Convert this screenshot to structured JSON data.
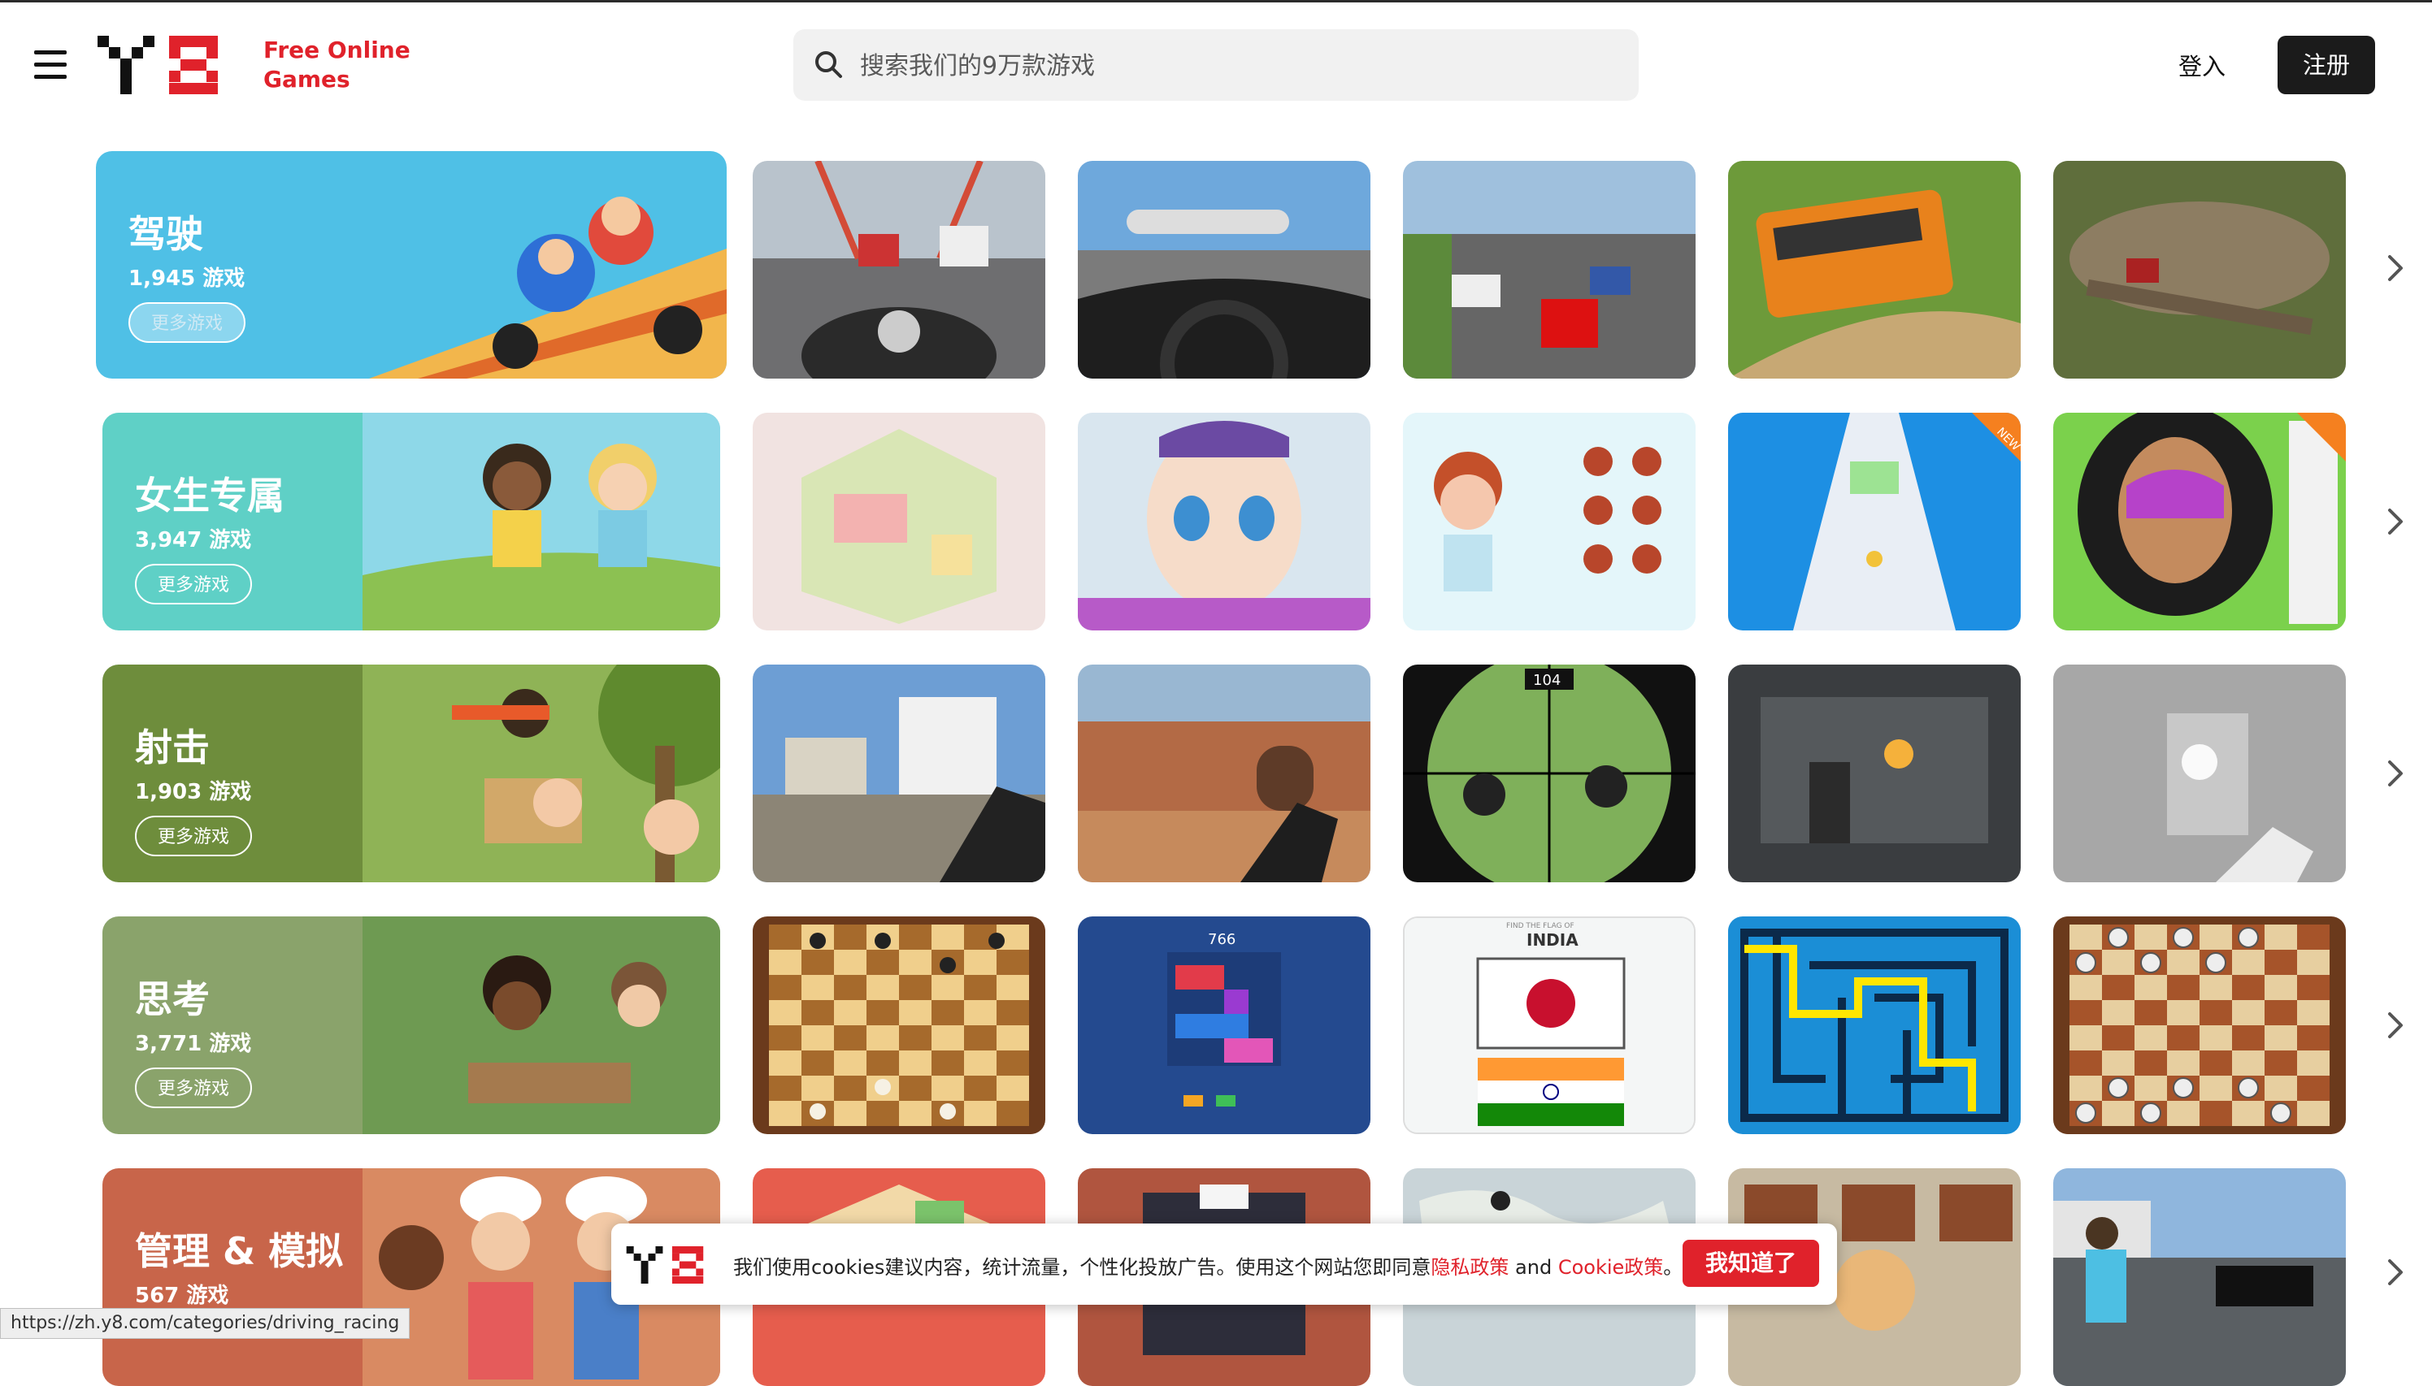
{
  "header": {
    "tagline_line1": "Free Online",
    "tagline_line2": "Games",
    "search_placeholder": "搜索我们的9万款游戏",
    "login_label": "登入",
    "register_label": "注册"
  },
  "categories": [
    {
      "title": "驾驶",
      "count": "1,945 游戏",
      "more_label": "更多游戏",
      "color": "#4fc0e6",
      "thumbnails": [
        "motorbike-highway",
        "car-cockpit-racing",
        "highway-traffic-racing",
        "bus-simulator",
        "offroad-monster-truck"
      ]
    },
    {
      "title": "女生专属",
      "count": "3,947 游戏",
      "more_label": "更多游戏",
      "color": "#5fd0c6",
      "thumbnails": [
        "room-decorating",
        "face-makeover",
        "avatar-dressup",
        "running-track-pool",
        "face-painting-makeup"
      ]
    },
    {
      "title": "射击",
      "count": "1,903 游戏",
      "more_label": "更多游戏",
      "color": "#6e8d3c",
      "thumbnails": [
        "fps-town",
        "fps-desert",
        "sniper-squid",
        "robot-shooter",
        "fps-gray-room"
      ]
    },
    {
      "title": "思考",
      "count": "3,771 游戏",
      "more_label": "更多游戏",
      "color": "#8aa36b",
      "thumbnails": [
        "chess-board",
        "block-puzzle",
        "flag-quiz",
        "maze",
        "checkers"
      ]
    },
    {
      "title": "管理 & 模拟",
      "count": "567 游戏",
      "more_label": "更多游戏",
      "color": "#c8654a",
      "thumbnails": [
        "isometric-factory",
        "cooking-counter",
        "world-map",
        "kitchen-grill",
        "police-chase"
      ]
    }
  ],
  "thumb_texts": {
    "block_puzzle_score": "766",
    "flag_quiz_header": "FIND THE FLAG OF",
    "flag_quiz_country": "INDIA",
    "sniper_number": "104",
    "new_badge": "NEW"
  },
  "cookie": {
    "text_before": "我们使用cookies建议内容，统计流量，个性化投放广告。使用这个网站您即同意",
    "privacy_link": "隐私政策",
    "and_text": " and ",
    "cookie_link": "Cookie政策",
    "end_text": "。",
    "accept_label": "我知道了"
  },
  "status_bar": {
    "url": "https://zh.y8.com/categories/driving_racing"
  },
  "colors": {
    "brand_red": "#e0222b",
    "dark_button": "#1b1b1b"
  }
}
